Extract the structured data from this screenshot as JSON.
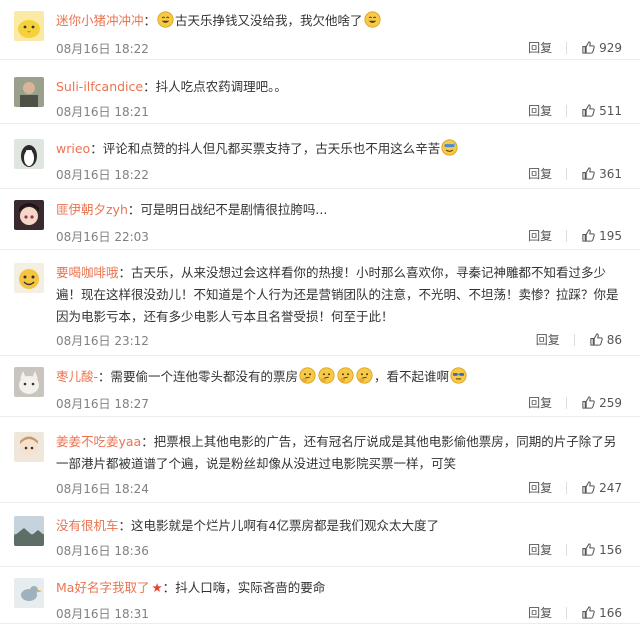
{
  "comments": [
    {
      "user": "迷你小猪冲冲冲",
      "parts": [
        {
          "e": "smile"
        },
        {
          "t": "古天乐挣钱又没给我，我欠他啥了"
        },
        {
          "e": "smile"
        }
      ],
      "time": "08月16日 18:22",
      "reply": "回复",
      "likes": "929",
      "avatar": "yellow-chick-avatar"
    },
    {
      "user": "Suli-ilfcandice",
      "parts": [
        {
          "t": "抖人吃点农药调理吧。。"
        }
      ],
      "time": "08月16日 18:21",
      "reply": "回复",
      "likes": "511",
      "avatar": "photo-avatar"
    },
    {
      "user": "wrieo",
      "parts": [
        {
          "t": "评论和点赞的抖人但凡都买票支持了，古天乐也不用这么辛苦"
        },
        {
          "e": "sweat"
        }
      ],
      "time": "08月16日 18:22",
      "reply": "回复",
      "likes": "361",
      "avatar": "penguin-avatar"
    },
    {
      "user": "匪伊朝夕zyh",
      "parts": [
        {
          "t": "可是明日战纪不是剧情很拉胯吗..."
        }
      ],
      "time": "08月16日 22:03",
      "reply": "回复",
      "likes": "195",
      "avatar": "anime-girl-avatar"
    },
    {
      "user": "要喝咖啡哦",
      "parts": [
        {
          "t": "古天乐，从来没想过会这样看你的热搜！小时那么喜欢你，寻秦记神雕都不知看过多少遍！现在这样很没劲儿！不知道是个人行为还是营销团队的注意，不光明、不坦荡！卖惨？拉踩？你是因为电影亏本，还有多少电影人亏本且名誉受损！何至于此！"
        }
      ],
      "time": "08月16日 23:12",
      "reply": "回复",
      "likes": "86",
      "avatar": "cartoon-face-avatar"
    },
    {
      "user": "枣儿酸-",
      "parts": [
        {
          "t": "需要偷一个连他零头都没有的票房"
        },
        {
          "e": "think"
        },
        {
          "e": "think"
        },
        {
          "e": "think"
        },
        {
          "e": "think"
        },
        {
          "t": "，看不起谁啊"
        },
        {
          "e": "shades"
        }
      ],
      "time": "08月16日 18:27",
      "reply": "回复",
      "likes": "259",
      "avatar": "cat-avatar"
    },
    {
      "user": "姜姜不吃姜yaa",
      "parts": [
        {
          "t": "把票根上其他电影的广告，还有冠名厅说成是其他电影偷他票房，同期的片子除了另一部港片都被道谱了个遍，说是粉丝却像从没进过电影院买票一样，可笑"
        }
      ],
      "time": "08月16日 18:24",
      "reply": "回复",
      "likes": "247",
      "avatar": "doll-avatar"
    },
    {
      "user": "没有很机车",
      "parts": [
        {
          "t": "这电影就是个烂片儿啊有4亿票房都是我们观众太大度了"
        }
      ],
      "time": "08月16日 18:36",
      "reply": "回复",
      "likes": "156",
      "avatar": "landscape-avatar"
    },
    {
      "user": "Ma好名字我取了",
      "badge": "★",
      "parts": [
        {
          "t": "抖人口嗨，实际吝啬的要命"
        }
      ],
      "time": "08月16日 18:31",
      "reply": "回复",
      "likes": "166",
      "avatar": "bird-avatar"
    }
  ]
}
